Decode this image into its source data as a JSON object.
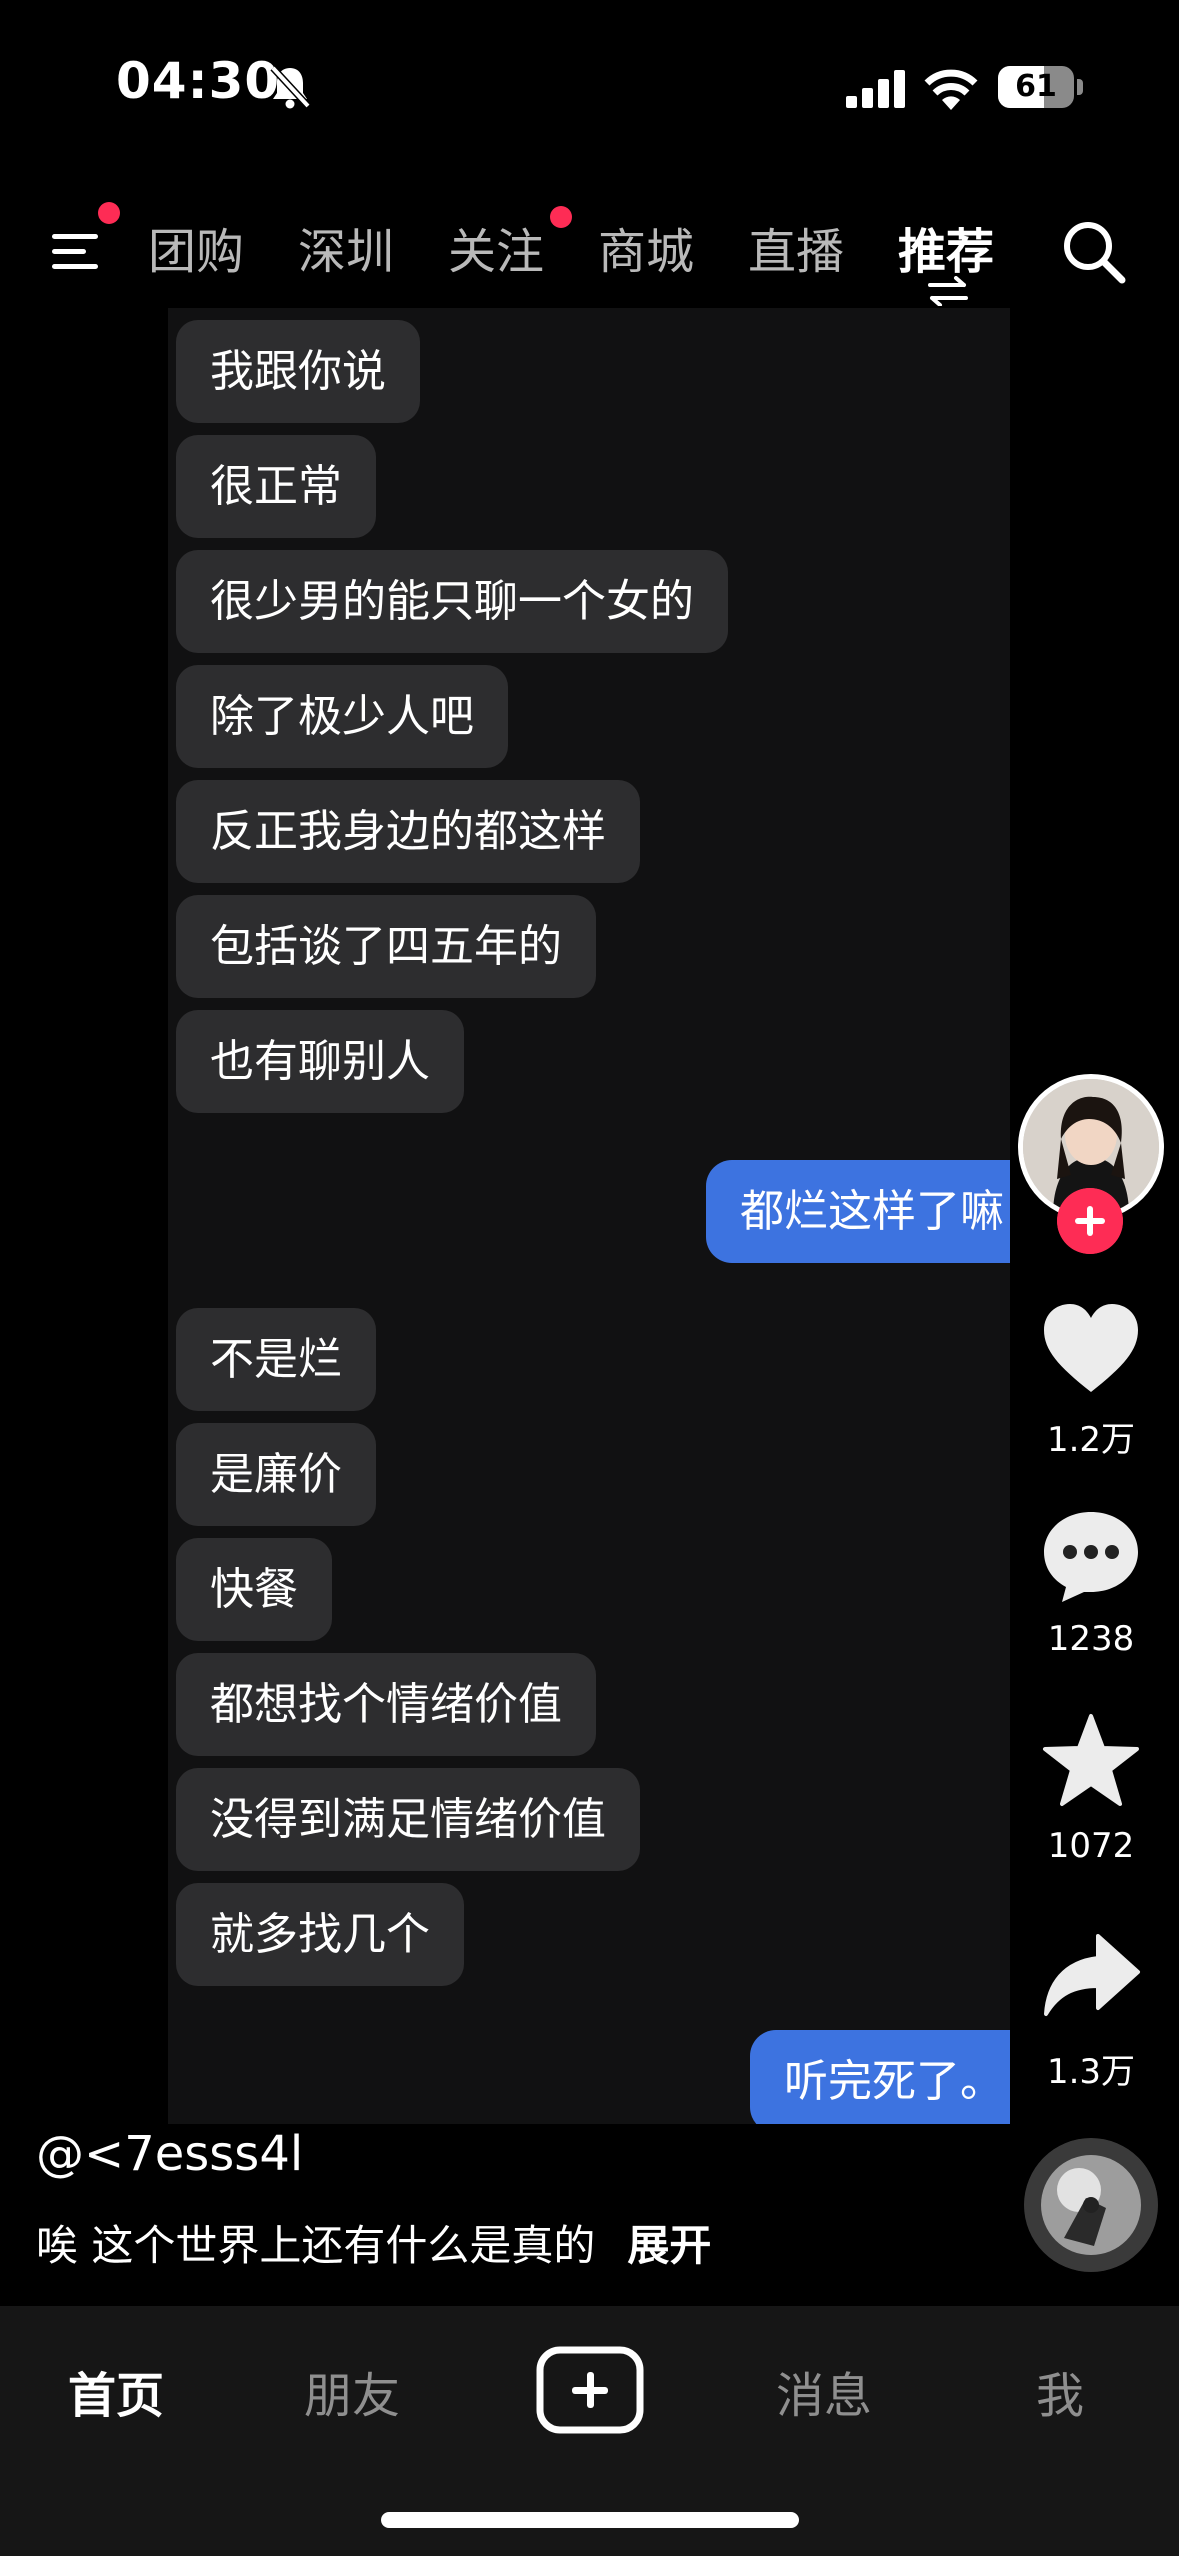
{
  "status_bar": {
    "time": "04:30",
    "battery_level": "61",
    "icons": [
      "bell-muted-icon",
      "cellular-signal-icon",
      "wifi-icon",
      "battery-icon"
    ]
  },
  "top_nav": {
    "tabs": [
      {
        "label": "团购",
        "active": false
      },
      {
        "label": "深圳",
        "active": false
      },
      {
        "label": "关注",
        "active": false,
        "badge": true
      },
      {
        "label": "商城",
        "active": false
      },
      {
        "label": "直播",
        "active": false
      },
      {
        "label": "推荐",
        "active": true
      }
    ],
    "menu_icon": "menu-icon",
    "search_icon": "search-icon"
  },
  "chat": {
    "messages": [
      {
        "from": "other",
        "text": "我跟你说"
      },
      {
        "from": "other",
        "text": "很正常"
      },
      {
        "from": "other",
        "text": "很少男的能只聊一个女的"
      },
      {
        "from": "other",
        "text": "除了极少人吧"
      },
      {
        "from": "other",
        "text": "反正我身边的都这样"
      },
      {
        "from": "other",
        "text": "包括谈了四五年的"
      },
      {
        "from": "other",
        "text": "也有聊别人"
      },
      {
        "from": "me",
        "text": "都烂这样了嘛"
      },
      {
        "from": "other",
        "text": "不是烂"
      },
      {
        "from": "other",
        "text": "是廉价"
      },
      {
        "from": "other",
        "text": "快餐"
      },
      {
        "from": "other",
        "text": "都想找个情绪价值"
      },
      {
        "from": "other",
        "text": "没得到满足情绪价值"
      },
      {
        "from": "other",
        "text": "就多找几个"
      },
      {
        "from": "me",
        "text": "听完死了。"
      }
    ]
  },
  "actions": {
    "likes": "1.2万",
    "comments": "1238",
    "favorites": "1072",
    "shares": "1.3万"
  },
  "post": {
    "author": "@<7esss4l",
    "caption": "唉 这个世界上还有什么是真的",
    "expand_label": "展开"
  },
  "tab_bar": {
    "home": "首页",
    "friends": "朋友",
    "messages": "消息",
    "me": "我"
  },
  "colors": {
    "accent_red": "#fe2c55",
    "my_bubble": "#3d73e0",
    "other_bubble": "#2d2d2f"
  }
}
